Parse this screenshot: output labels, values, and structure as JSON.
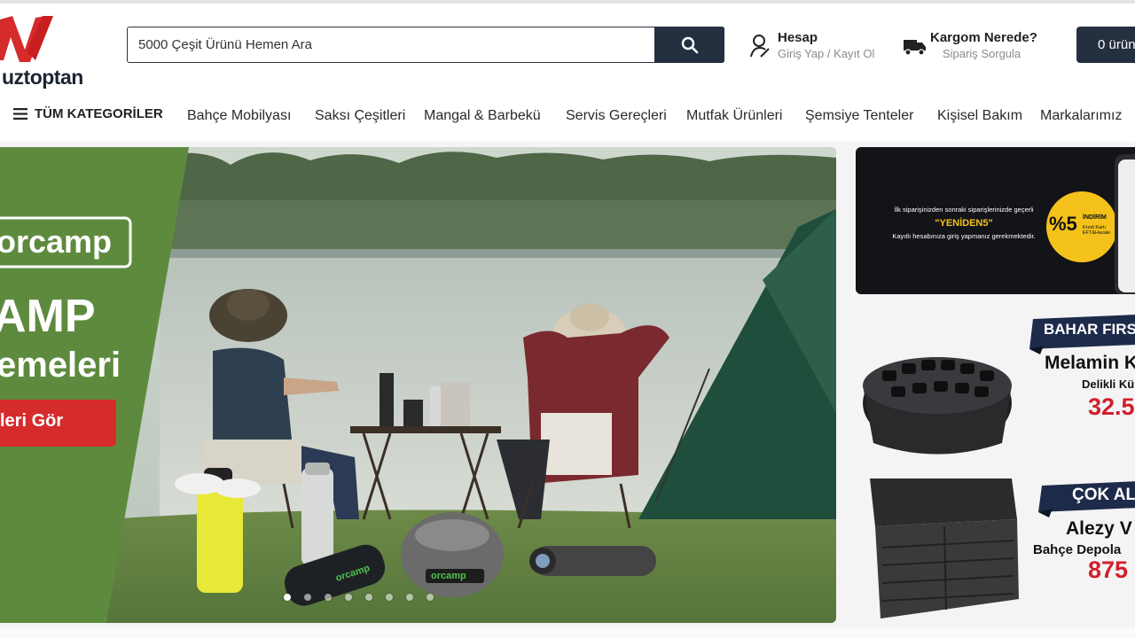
{
  "header": {
    "logo_text": "uztoptan",
    "search_placeholder": "5000 Çeşit Ürünü Hemen Ara",
    "account_title": "Hesap",
    "account_sub": "Giriş Yap / Kayıt Ol",
    "cargo_title": "Kargom Nerede?",
    "cargo_sub": "Sipariş Sorgula",
    "cart_label": "0 ürün"
  },
  "nav": {
    "all_categories": "TÜM KATEGORİLER",
    "items": [
      "Bahçe Mobilyası",
      "Saksı Çeşitleri",
      "Mangal & Barbekü",
      "Servis Gereçleri",
      "Mutfak Ürünleri",
      "Şemsiye Tenteler",
      "Kişisel Bakım",
      "Markalarımız"
    ]
  },
  "hero": {
    "brand": "orcamp",
    "title": "AMP",
    "subtitle": "emeleri",
    "cta": "leri Gör",
    "product_brand": "orcamp",
    "slide_count": 8,
    "active_slide": 1
  },
  "side_banner": {
    "line1": "İlk siparişinizden sonraki siparişlerinizde geçerli",
    "code": "\"YENİDEN5\"",
    "line3": "Kayıtlı hesabınıza giriş yapmanız gerekmektedir.",
    "badge_pct": "%5",
    "badge_word": "İNDİRİM",
    "badge_sub": "Kredi Kartı EFT&Havale"
  },
  "promo1": {
    "ribbon": "BAHAR FIRS",
    "title": "Melamin K",
    "sub": "Delikli Kü",
    "price": "32.5"
  },
  "promo2": {
    "ribbon": "ÇOK AL",
    "title": "Alezy V",
    "sub": "Bahçe Depola",
    "price": "875"
  },
  "colors": {
    "dark": "#242f40",
    "brand_red": "#d62b2b",
    "hero_green": "#5e8a3e",
    "ribbon_navy": "#1d2a4a",
    "price_red": "#d21f2b"
  }
}
